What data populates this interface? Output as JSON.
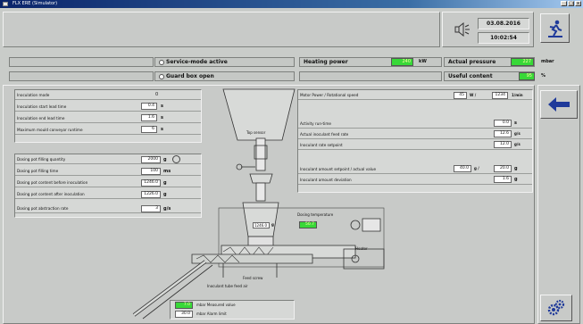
{
  "window": {
    "title": "FLX ERE (Simulator)",
    "min": "_",
    "max": "□",
    "close": "x"
  },
  "header": {
    "date": "03.08.2016",
    "time": "10:02:54"
  },
  "status": {
    "service_mode": "Service-mode active",
    "guard_box": "Guard box open",
    "heating_power_label": "Heating power",
    "heating_power_value": "240",
    "heating_power_unit": "kW",
    "actual_pressure_label": "Actual pressure",
    "actual_pressure_value": "227",
    "actual_pressure_unit": "mbar",
    "useful_content_label": "Useful content",
    "useful_content_value": "95",
    "useful_content_unit": "%"
  },
  "left_params": [
    {
      "label": "Inoculation mode",
      "value": "0",
      "unit": ""
    },
    {
      "label": "Inoculation start lead time",
      "value": "0.4",
      "unit": "s"
    },
    {
      "label": "Inoculation end lead time",
      "value": "1.6",
      "unit": "s"
    },
    {
      "label": "Maximum mould conveyor runtime",
      "value": "6",
      "unit": "s"
    }
  ],
  "dosing_params": [
    {
      "label": "Dosing pot filling quantity",
      "value": "2000",
      "unit": "g"
    },
    {
      "label": "Dosing pot filling time",
      "value": "100",
      "unit": "ms"
    },
    {
      "label": "Dosing pot content before inoculation",
      "value": "1246.0",
      "unit": "g"
    },
    {
      "label": "Dosing pot content after inoculation",
      "value": "1226.0",
      "unit": "g"
    },
    {
      "label": "Dosing pot abstraction rate",
      "value": "3",
      "unit": "g/s"
    }
  ],
  "right_params": {
    "motor_label": "Motor Power / Rotational speed",
    "motor_value1": "45",
    "motor_unit1": "W /",
    "motor_value2": "1234",
    "motor_unit2": "1/min",
    "rows": [
      {
        "label": "Activity run-time",
        "value": "0.0",
        "unit": "s"
      },
      {
        "label": "Actual inoculant feed rate",
        "value": "12.6",
        "unit": "g/s"
      },
      {
        "label": "Inoculant rate setpoint",
        "value": "12.0",
        "unit": "g/s"
      }
    ],
    "amount_label": "Inoculant amount setpoint / actual value",
    "amount_value1": "40.0",
    "amount_unit1": "g /",
    "amount_value2": "20.0",
    "amount_unit2": "g",
    "deviation_label": "Inoculant amount deviation",
    "deviation_value": "1.6",
    "deviation_unit": "g"
  },
  "diagram": {
    "top_sensor": "Top sensor",
    "dosing_temperature": "Dosing temperature",
    "temp_value": "50.7",
    "pot_value": "1246.0",
    "pot_unit": "g",
    "feed_screw": "Feed screw",
    "inoculant_feed": "Inoculant tube feed air",
    "heater": "Heater"
  },
  "legend": {
    "measured_value": "7.0",
    "measured_label": "mbar Measured value",
    "alarm_value": "30.0",
    "alarm_label": "mbar Alarm limit"
  },
  "colors": {
    "accent_green": "#38d838",
    "arrow_blue": "#1f3a9a"
  }
}
